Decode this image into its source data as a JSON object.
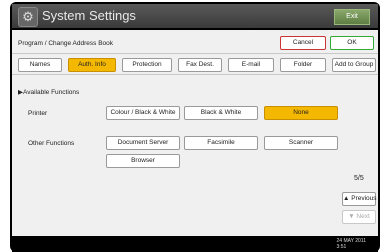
{
  "window": {
    "title": "System Settings",
    "exit_label": "Exit"
  },
  "header": {
    "breadcrumb": "Program / Change Address Book",
    "cancel_label": "Cancel",
    "ok_label": "OK"
  },
  "tabs": [
    {
      "label": "Names",
      "active": false
    },
    {
      "label": "Auth. Info",
      "active": true
    },
    {
      "label": "Protection",
      "active": false
    },
    {
      "label": "Fax Dest.",
      "active": false
    },
    {
      "label": "E-mail",
      "active": false
    },
    {
      "label": "Folder",
      "active": false
    },
    {
      "label": "Add to Group",
      "active": false
    }
  ],
  "available_functions": {
    "heading": "▶Available Functions",
    "printer_label": "Printer",
    "printer_options": [
      "Colour / Black & White",
      "Black & White",
      "None"
    ],
    "printer_selected": "None",
    "other_label": "Other Functions",
    "other_options": [
      "Document Server",
      "Facsimile",
      "Scanner",
      "Browser"
    ]
  },
  "pagination": {
    "page": "5/5",
    "previous_label": "▲ Previous",
    "next_label": "▼ Next"
  },
  "status": {
    "date": "24 MAY  2011",
    "time": "3:51"
  },
  "colors": {
    "accent_selected": "#f5b800",
    "titlebar": "#4a4a4a",
    "exit": "#6b8e4e"
  }
}
